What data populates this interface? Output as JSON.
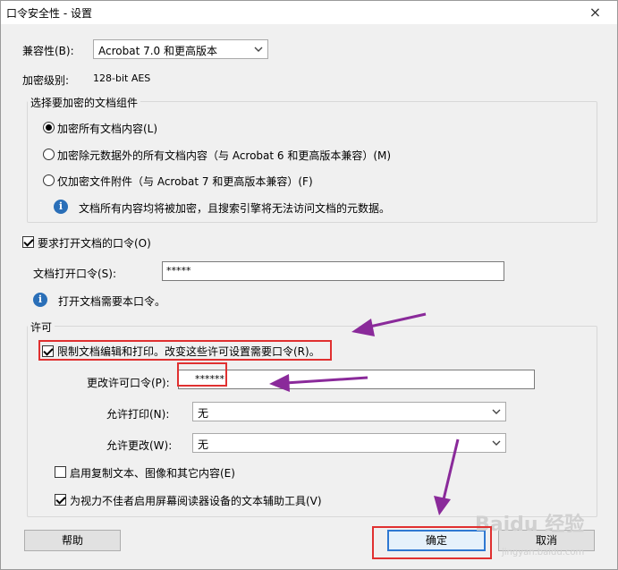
{
  "window": {
    "title": "口令安全性 - 设置",
    "close_glyph": "×"
  },
  "compat": {
    "label": "兼容性(B):",
    "value": "Acrobat 7.0 和更高版本"
  },
  "encryption": {
    "label": "加密级别:",
    "value": "128-bit AES"
  },
  "components": {
    "title": "选择要加密的文档组件",
    "options": [
      {
        "label": "加密所有文档内容(L)",
        "selected": true
      },
      {
        "label": "加密除元数据外的所有文档内容（与 Acrobat 6 和更高版本兼容）(M)",
        "selected": false
      },
      {
        "label": "仅加密文件附件（与 Acrobat 7 和更高版本兼容）(F)",
        "selected": false
      }
    ],
    "info": "文档所有内容均将被加密，且搜索引擎将无法访问文档的元数据。"
  },
  "open_password": {
    "require_label": "要求打开文档的口令(O)",
    "require_checked": true,
    "field_label": "文档打开口令(S):",
    "field_value": "*****",
    "info": "打开文档需要本口令。"
  },
  "permissions": {
    "title": "许可",
    "restrict_label": "限制文档编辑和打印。改变这些许可设置需要口令(R)。",
    "restrict_checked": true,
    "change_label": "更改许可口令(P):",
    "change_value": "******",
    "print_label": "允许打印(N):",
    "print_value": "无",
    "changes_label": "允许更改(W):",
    "changes_value": "无",
    "copy_label": "启用复制文本、图像和其它内容(E)",
    "copy_checked": false,
    "a11y_label": "为视力不佳者启用屏幕阅读器设备的文本辅助工具(V)",
    "a11y_checked": true
  },
  "buttons": {
    "help": "帮助",
    "ok": "确定",
    "cancel": "取消"
  },
  "watermark": {
    "brand": "Baidu 经验",
    "url": "jingyan.baidu.com"
  },
  "annotation_color": "#8a2a9a",
  "highlight_color": "#e03030"
}
